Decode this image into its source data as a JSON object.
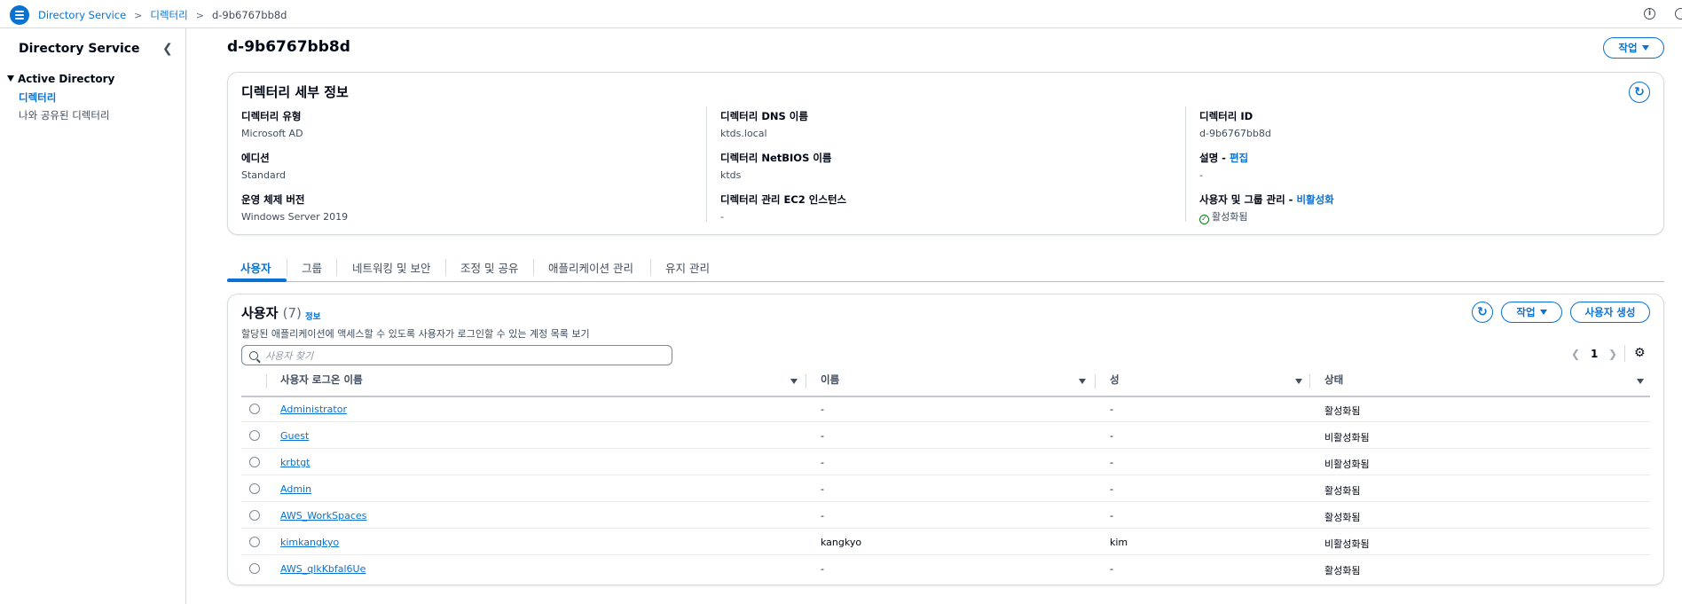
{
  "breadcrumb": [
    "Directory Service",
    "디렉터리",
    "d-9b6767bb8d"
  ],
  "sidebar": {
    "title": "Directory Service",
    "group": "Active Directory",
    "items": [
      "디렉터리",
      "나와 공유된 디렉터리"
    ]
  },
  "page": {
    "title": "d-9b6767bb8d",
    "action_label": "작업"
  },
  "details": {
    "title": "디렉터리 세부 정보",
    "col1": [
      {
        "label": "디렉터리 유형",
        "value": "Microsoft AD"
      },
      {
        "label": "에디션",
        "value": "Standard"
      },
      {
        "label": "운영 체제 버전",
        "value": "Windows Server 2019"
      }
    ],
    "col2": [
      {
        "label": "디렉터리 DNS 이름",
        "value": "ktds.local"
      },
      {
        "label": "디렉터리 NetBIOS 이름",
        "value": "ktds"
      },
      {
        "label": "디렉터리 관리 EC2 인스턴스",
        "value": "-"
      }
    ],
    "col3": [
      {
        "label": "디렉터리 ID",
        "value": "d-9b6767bb8d"
      },
      {
        "label": "설명",
        "link": "편집",
        "value": "-"
      },
      {
        "label": "사용자 및 그룹 관리",
        "link": "비활성화",
        "value": "활성화됨"
      }
    ]
  },
  "tabs": [
    "사용자",
    "그룹",
    "네트워킹 및 보안",
    "조정 및 공유",
    "애플리케이션 관리",
    "유지 관리"
  ],
  "users": {
    "title": "사용자",
    "count": "(7)",
    "info": "정보",
    "description": "할당된 애플리케이션에 액세스할 수 있도록 사용자가 로그인할 수 있는 계정 목록 보기",
    "action_label": "작업",
    "create_label": "사용자 생성",
    "search_placeholder": "사용자 찾기",
    "page": "1",
    "columns": [
      "사용자 로그온 이름",
      "이름",
      "성",
      "상태"
    ],
    "rows": [
      {
        "logon": "Administrator",
        "first": "-",
        "last": "-",
        "status": "활성화됨"
      },
      {
        "logon": "Guest",
        "first": "-",
        "last": "-",
        "status": "비활성화됨"
      },
      {
        "logon": "krbtgt",
        "first": "-",
        "last": "-",
        "status": "비활성화됨"
      },
      {
        "logon": "Admin",
        "first": "-",
        "last": "-",
        "status": "활성화됨"
      },
      {
        "logon": "AWS_WorkSpaces",
        "first": "-",
        "last": "-",
        "status": "활성화됨"
      },
      {
        "logon": "kimkangkyo",
        "first": "kangkyo",
        "last": "kim",
        "status": "비활성화됨"
      },
      {
        "logon": "AWS_qlkKbfal6Ue",
        "first": "-",
        "last": "-",
        "status": "활성화됨"
      }
    ]
  },
  "colors": {
    "accent": "#0972d3",
    "success": "#037f0c"
  }
}
